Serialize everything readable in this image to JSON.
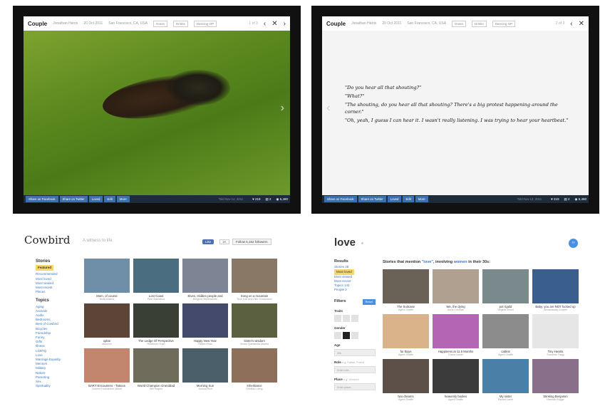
{
  "viewer_photo": {
    "title": "Couple",
    "author": "Jonathan Harris",
    "date": "20 Oct 2011",
    "location": "San Francisco, CA, USA",
    "tags": [
      "Grass",
      "Drinks",
      "Dancing OP"
    ],
    "page": "1 of 3",
    "footer_buttons": [
      "Share on Facebook",
      "Share on Twitter",
      "Loved",
      "Edit",
      "More"
    ],
    "footer_date": "Told Nov 14, 2011",
    "loves": "♥ 219",
    "stories": "▤ 2",
    "views": "◉ 6,480"
  },
  "viewer_text": {
    "title": "Couple",
    "author": "Jonathan Harris",
    "date": "20 Oct 2011",
    "location": "San Francisco, CA, USA",
    "tags": [
      "Grass",
      "Drinks",
      "Dancing OP"
    ],
    "page": "2 of 3",
    "quote": [
      "\"Do you hear all that shouting?\"",
      "\"What?\"",
      "\"The shouting, do you hear all that shouting? There's a big protest happening around the corner.\"",
      "\"Oh, yeah, I guess I can hear it. I wasn't really listening. I was trying to hear your heartbeat.\""
    ],
    "footer_buttons": [
      "Share on Facebook",
      "Share on Twitter",
      "Loved",
      "Edit",
      "More"
    ],
    "footer_date": "Told Nov 14, 2011",
    "loves": "♥ 219",
    "stories": "▤ 2",
    "views": "◉ 6,480"
  },
  "cowbird": {
    "logo": "Cowbird",
    "tagline": "A witness to life.",
    "like": "Like",
    "like_count": "1K",
    "follow": "Follow  5,152 followers",
    "stories_heading": "Stories",
    "stories_items": [
      "Featured",
      "Recommended",
      "Most loved",
      "Most viewed",
      "Most recent",
      "Places"
    ],
    "topics_heading": "Topics",
    "topics_items": [
      "Aging",
      "Animals",
      "Audio",
      "Bedrooms",
      "Best of Cowbird",
      "Bicycles",
      "Friendship",
      "Funny",
      "Gifts",
      "Illness",
      "LGBTQ",
      "Love",
      "Marriage Equality",
      "Mentors",
      "Military",
      "Nature",
      "Parenting",
      "Sex",
      "Spirituality"
    ],
    "cards": [
      {
        "title": "Mom, of course",
        "author": "Molly Adams",
        "color": "#6f8fa8"
      },
      {
        "title": "Lost Coast",
        "author": "Paul Stamatiou",
        "color": "#4a6d7f"
      },
      {
        "title": "Elves, Hidden people and",
        "author": "Berglind Stefánsdóttir",
        "color": "#7d8594"
      },
      {
        "title": "Song on a mountain",
        "author": "Tove Ivar and Ollie Grossmann",
        "color": "#8a7866"
      },
      {
        "title": "xplan",
        "author": "alma fox",
        "color": "#5c4536"
      },
      {
        "title": "The Ledge Of Perspective",
        "author": "Rhiannon Chan",
        "color": "#3a3f35"
      },
      {
        "title": "Happy New Year",
        "author": "Rakan Khan",
        "color": "#434a6b"
      },
      {
        "title": "Sister's wisdom",
        "author": "Vivian Quintanilla-Madrid",
        "color": "#5a6040"
      },
      {
        "title": "BART Encounters - Tattoos",
        "author": "Corinne Hutchinson Moore",
        "color": "#c2866e"
      },
      {
        "title": "World Champion Granddad",
        "author": "Will Rogers",
        "color": "#6f6c5c"
      },
      {
        "title": "Morning Sun",
        "author": "Joshua Rich",
        "color": "#4b5f6b"
      },
      {
        "title": "Inheritance",
        "author": "Kristina Loring",
        "color": "#8e6f5a"
      }
    ]
  },
  "love": {
    "title": "love",
    "results_heading": "Results",
    "results_items": [
      "Stories 48",
      "Most loved",
      "Most viewed",
      "Most recent",
      "Topics 142",
      "People 2"
    ],
    "filters_heading": "Filters",
    "reset": "Reset",
    "traits_label": "Traits",
    "gender_label": "Gender",
    "age_label": "Age",
    "age_value": "30s",
    "role_label": "Role",
    "role_hint": "e.g. Father, Friend",
    "role_placeholder": "Enter role...",
    "place_label": "Place",
    "place_hint": "e.g. Vermont",
    "place_placeholder": "Enter place...",
    "heading_prefix": "Stories that mention ",
    "heading_term": "\"love\"",
    "heading_mid": ", involving ",
    "heading_who": "women",
    "heading_suffix": " in their 30s:",
    "cards": [
      {
        "title": "The Suitcase",
        "author": "Agent Giraffe",
        "color": "#6a6257"
      },
      {
        "title": "We, the dying",
        "author": "Anna Cochran",
        "color": "#b0a090"
      },
      {
        "title": "pot rigidd",
        "author": "Virginia Wood",
        "color": "#7a8a8c"
      },
      {
        "title": "Baby, you are NOT fucked up",
        "author": "Annaclaudia Crowell",
        "color": "#3a5f8f"
      },
      {
        "title": "for Boys",
        "author": "Agent Giraffe",
        "color": "#d9b48a"
      },
      {
        "title": "Happiness at 11.5 Months",
        "author": "Diana Laurel",
        "color": "#b466b4"
      },
      {
        "title": "cabinit",
        "author": "Agent Giraffe",
        "color": "#8c8c8c"
      },
      {
        "title": "Tiny Hearts",
        "author": "Suzanne Flagg",
        "color": "#e6e6e6"
      },
      {
        "title": "two dreams",
        "author": "Agent Giraffe",
        "color": "#5c5048"
      },
      {
        "title": "heavenly bodies",
        "author": "Agent Giraffe",
        "color": "#3b3b3b"
      },
      {
        "title": "My sister",
        "author": "Rachel Lauer",
        "color": "#4a7fa8"
      },
      {
        "title": "Stinking Benjamin",
        "author": "Hannah Rogge",
        "color": "#8a6f8a"
      }
    ]
  }
}
